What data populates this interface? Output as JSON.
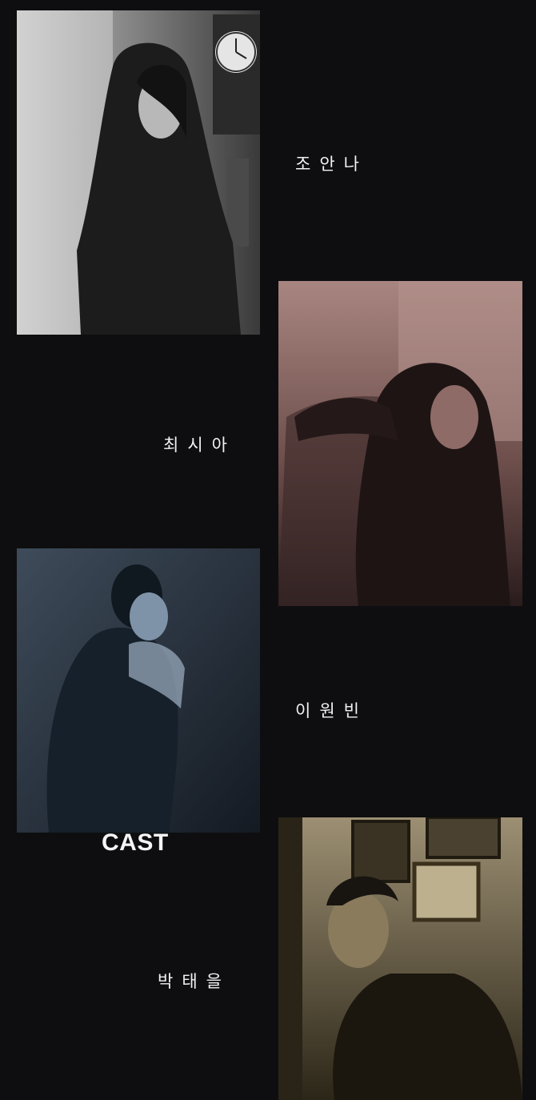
{
  "section_title": "CAST",
  "cast": [
    {
      "name": "조안나",
      "tone": "grayscale"
    },
    {
      "name": "최시아",
      "tone": "rose"
    },
    {
      "name": "이원빈",
      "tone": "blue"
    },
    {
      "name": "박태을",
      "tone": "sepia"
    }
  ],
  "colors": {
    "background": "#0e0e10",
    "text": "#f2f2f2"
  }
}
